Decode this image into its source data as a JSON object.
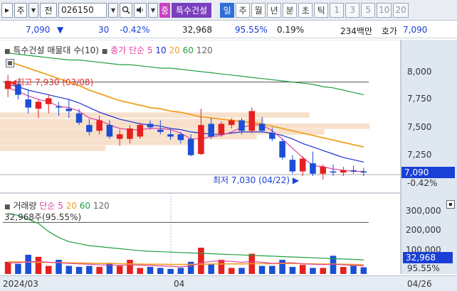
{
  "toolbar": {
    "market_label": "주",
    "type_label": "전",
    "code": "026150",
    "stock_name": "특수건설",
    "sel_badge": "중",
    "periods": [
      "일",
      "주",
      "월",
      "년",
      "분",
      "초",
      "틱"
    ],
    "active_period": "일",
    "numbers": [
      "1",
      "3",
      "5",
      "10",
      "20"
    ]
  },
  "quote": {
    "price": "7,090",
    "direction": "▼",
    "change": "30",
    "change_pct": "-0.42%",
    "volume": "32,968",
    "volume_ratio": "95.55%",
    "turnover": "0.19%",
    "amount": "234백만",
    "ask_label": "호가",
    "ask_price": "7,090"
  },
  "chart": {
    "legend_vp": "특수건설 매물대 수(10)",
    "legend_ma_prefix": "종가 단순",
    "ma_periods": [
      "5",
      "10",
      "20",
      "60",
      "120"
    ],
    "ma_colors": [
      "#e040a0",
      "#2030d0",
      "#f0a020",
      "#20a040",
      "#555555"
    ],
    "high_marker": "최고 7,930 (03/08)",
    "low_marker": "최저 7,030 (04/22)",
    "price_ticks": [
      "8,000",
      "7,750",
      "7,500",
      "7,250"
    ],
    "current_price": "7,090",
    "current_change": "-0.42%",
    "vol_legend_label": "거래량",
    "vol_legend_ma": "단순",
    "vol_ma_periods": [
      "5",
      "20",
      "60",
      "120"
    ],
    "vol_value_label": "32,968주(95.55%)",
    "vol_ticks": [
      "300,000",
      "200,000",
      "100,000"
    ],
    "vol_current": "32,968",
    "vol_current_pct": "95.55%",
    "dates": [
      "2024/03",
      "04",
      "04/26"
    ]
  },
  "chart_data": {
    "type": "candlestick",
    "price_ylim": [
      6950,
      8100
    ],
    "candles": [
      {
        "o": 7810,
        "h": 7930,
        "l": 7740,
        "c": 7880,
        "up": true
      },
      {
        "o": 7850,
        "h": 7880,
        "l": 7720,
        "c": 7760,
        "up": false
      },
      {
        "o": 7720,
        "h": 7800,
        "l": 7600,
        "c": 7650,
        "up": false
      },
      {
        "o": 7640,
        "h": 7720,
        "l": 7560,
        "c": 7700,
        "up": true
      },
      {
        "o": 7680,
        "h": 7760,
        "l": 7600,
        "c": 7730,
        "up": true
      },
      {
        "o": 7660,
        "h": 7700,
        "l": 7580,
        "c": 7650,
        "up": false
      },
      {
        "o": 7640,
        "h": 7720,
        "l": 7560,
        "c": 7620,
        "up": false
      },
      {
        "o": 7600,
        "h": 7640,
        "l": 7500,
        "c": 7520,
        "up": false
      },
      {
        "o": 7500,
        "h": 7550,
        "l": 7410,
        "c": 7440,
        "up": false
      },
      {
        "o": 7450,
        "h": 7580,
        "l": 7420,
        "c": 7540,
        "up": true
      },
      {
        "o": 7500,
        "h": 7540,
        "l": 7380,
        "c": 7400,
        "up": false
      },
      {
        "o": 7380,
        "h": 7460,
        "l": 7320,
        "c": 7420,
        "up": true
      },
      {
        "o": 7380,
        "h": 7500,
        "l": 7340,
        "c": 7470,
        "up": true
      },
      {
        "o": 7400,
        "h": 7520,
        "l": 7380,
        "c": 7500,
        "up": true
      },
      {
        "o": 7510,
        "h": 7540,
        "l": 7460,
        "c": 7480,
        "up": false
      },
      {
        "o": 7460,
        "h": 7540,
        "l": 7420,
        "c": 7440,
        "up": false
      },
      {
        "o": 7420,
        "h": 7460,
        "l": 7370,
        "c": 7400,
        "up": false
      },
      {
        "o": 7420,
        "h": 7440,
        "l": 7340,
        "c": 7370,
        "up": false
      },
      {
        "o": 7380,
        "h": 7420,
        "l": 7230,
        "c": 7240,
        "up": false
      },
      {
        "o": 7250,
        "h": 7640,
        "l": 7240,
        "c": 7500,
        "up": true
      },
      {
        "o": 7510,
        "h": 7560,
        "l": 7380,
        "c": 7400,
        "up": false
      },
      {
        "o": 7420,
        "h": 7530,
        "l": 7400,
        "c": 7510,
        "up": true
      },
      {
        "o": 7500,
        "h": 7560,
        "l": 7470,
        "c": 7540,
        "up": true
      },
      {
        "o": 7540,
        "h": 7560,
        "l": 7420,
        "c": 7450,
        "up": false
      },
      {
        "o": 7450,
        "h": 7650,
        "l": 7430,
        "c": 7620,
        "up": true
      },
      {
        "o": 7510,
        "h": 7570,
        "l": 7440,
        "c": 7450,
        "up": false
      },
      {
        "o": 7430,
        "h": 7480,
        "l": 7360,
        "c": 7380,
        "up": false
      },
      {
        "o": 7360,
        "h": 7380,
        "l": 7200,
        "c": 7220,
        "up": false
      },
      {
        "o": 7200,
        "h": 7240,
        "l": 7080,
        "c": 7100,
        "up": false
      },
      {
        "o": 7100,
        "h": 7230,
        "l": 7060,
        "c": 7210,
        "up": true
      },
      {
        "o": 7170,
        "h": 7270,
        "l": 7060,
        "c": 7080,
        "up": false
      },
      {
        "o": 7080,
        "h": 7160,
        "l": 7030,
        "c": 7140,
        "up": true
      },
      {
        "o": 7100,
        "h": 7160,
        "l": 7060,
        "c": 7090,
        "up": false
      },
      {
        "o": 7090,
        "h": 7140,
        "l": 7060,
        "c": 7110,
        "up": true
      },
      {
        "o": 7110,
        "h": 7150,
        "l": 7080,
        "c": 7100,
        "up": false
      },
      {
        "o": 7100,
        "h": 7130,
        "l": 7060,
        "c": 7090,
        "up": false
      }
    ],
    "ma5": [
      7820,
      7790,
      7750,
      7720,
      7700,
      7660,
      7650,
      7620,
      7560,
      7540,
      7500,
      7470,
      7460,
      7460,
      7470,
      7470,
      7460,
      7430,
      7380,
      7380,
      7400,
      7410,
      7440,
      7480,
      7500,
      7500,
      7450,
      7380,
      7300,
      7220,
      7150,
      7140,
      7120,
      7110,
      7100,
      7100
    ],
    "ma10": [
      7850,
      7830,
      7800,
      7780,
      7760,
      7740,
      7720,
      7690,
      7650,
      7610,
      7580,
      7550,
      7530,
      7510,
      7500,
      7490,
      7470,
      7460,
      7440,
      7430,
      7420,
      7420,
      7430,
      7440,
      7440,
      7440,
      7430,
      7410,
      7380,
      7340,
      7310,
      7280,
      7250,
      7220,
      7200,
      7180
    ],
    "ma20": [
      8050,
      8020,
      7990,
      7960,
      7930,
      7900,
      7870,
      7840,
      7800,
      7770,
      7740,
      7710,
      7690,
      7670,
      7650,
      7640,
      7620,
      7610,
      7590,
      7570,
      7560,
      7550,
      7540,
      7530,
      7520,
      7510,
      7490,
      7470,
      7450,
      7430,
      7410,
      7390,
      7370,
      7350,
      7330,
      7310
    ],
    "ma60": [
      8120,
      8110,
      8100,
      8090,
      8080,
      8070,
      8060,
      8060,
      8050,
      8040,
      8030,
      8020,
      8020,
      8010,
      8000,
      7990,
      7990,
      7980,
      7970,
      7960,
      7950,
      7940,
      7930,
      7920,
      7910,
      7900,
      7890,
      7880,
      7870,
      7860,
      7850,
      7830,
      7820,
      7800,
      7780,
      7760
    ],
    "ma120_level": 7870,
    "volume_ylim": [
      0,
      330000
    ],
    "volumes": [
      60000,
      50000,
      95000,
      85000,
      40000,
      70000,
      40000,
      35000,
      40000,
      35000,
      55000,
      40000,
      70000,
      30000,
      35000,
      30000,
      25000,
      30000,
      60000,
      130000,
      50000,
      70000,
      30000,
      30000,
      100000,
      40000,
      40000,
      70000,
      35000,
      45000,
      30000,
      30000,
      90000,
      35000,
      40000,
      33000
    ],
    "vol_ma5": [
      55000,
      55000,
      60000,
      62000,
      58000,
      55000,
      52000,
      50000,
      48000,
      45000,
      44000,
      43000,
      45000,
      44000,
      42000,
      40000,
      38000,
      35000,
      40000,
      55000,
      62000,
      65000,
      62000,
      58000,
      62000,
      58000,
      52000,
      55000,
      55000,
      50000,
      48000,
      46000,
      48000,
      45000,
      42000,
      40000
    ],
    "vol_ma20": [
      60000,
      60000,
      59000,
      58000,
      57000,
      56000,
      55000,
      54000,
      53000,
      52000,
      52000,
      51000,
      50000,
      49000,
      48000,
      48000,
      47000,
      47000,
      47000,
      48000,
      49000,
      50000,
      50000,
      50000,
      51000,
      51000,
      51000,
      52000,
      52000,
      51000,
      50000,
      49000,
      49000,
      48000,
      47000,
      46000
    ],
    "vol_ma60": [
      300000,
      290000,
      270000,
      250000,
      210000,
      180000,
      160000,
      150000,
      140000,
      135000,
      130000,
      125000,
      120000,
      115000,
      112000,
      110000,
      108000,
      106000,
      104000,
      102000,
      100000,
      98000,
      96000,
      94000,
      92000,
      90000,
      88000,
      86000,
      84000,
      82000,
      80000,
      78000,
      76000,
      74000,
      72000,
      70000
    ],
    "vol_ma120_level": 255000,
    "volume_profile": [
      {
        "price": 7585,
        "share": 0.82
      },
      {
        "price": 7530,
        "share": 0.7
      },
      {
        "price": 7490,
        "share": 0.98
      },
      {
        "price": 7440,
        "share": 0.86
      },
      {
        "price": 7400,
        "share": 0.68
      },
      {
        "price": 7350,
        "share": 0.5
      },
      {
        "price": 7300,
        "share": 0.28
      }
    ]
  }
}
